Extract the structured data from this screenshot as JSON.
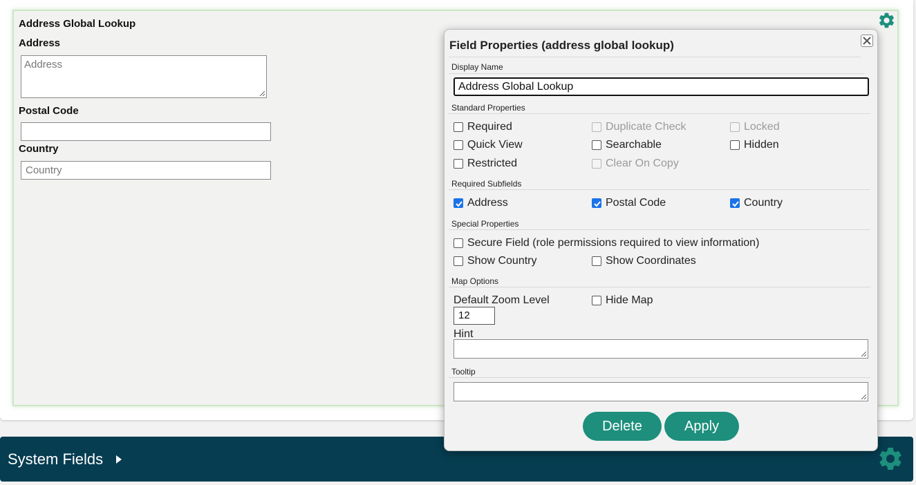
{
  "form": {
    "field_title": "Address Global Lookup",
    "address_label": "Address",
    "address_placeholder": "Address",
    "postal_label": "Postal Code",
    "postal_value": "",
    "country_label": "Country",
    "country_placeholder": "Country"
  },
  "bottom_bar": {
    "title": "System Fields"
  },
  "dialog": {
    "title": "Field Properties (address global lookup)",
    "display_name_label": "Display Name",
    "display_name_value": "Address Global Lookup",
    "standard_label": "Standard Properties",
    "standard": {
      "required": "Required",
      "duplicate_check": "Duplicate Check",
      "locked": "Locked",
      "quick_view": "Quick View",
      "searchable": "Searchable",
      "hidden": "Hidden",
      "restricted": "Restricted",
      "clear_on_copy": "Clear On Copy"
    },
    "subfields_label": "Required Subfields",
    "subfields": {
      "address": "Address",
      "postal_code": "Postal Code",
      "country": "Country"
    },
    "special_label": "Special Properties",
    "special": {
      "secure_field": "Secure Field (role permissions required to view information)",
      "show_country": "Show Country",
      "show_coordinates": "Show Coordinates"
    },
    "map_label": "Map Options",
    "map": {
      "zoom_label": "Default Zoom Level",
      "zoom_value": "12",
      "hide_map": "Hide Map"
    },
    "hint_label": "Hint",
    "tooltip_label": "Tooltip",
    "delete_label": "Delete",
    "apply_label": "Apply"
  },
  "colors": {
    "accent_teal": "#1d8f7c",
    "bar_navy": "#063d51",
    "checkbox_blue": "#1a73e8"
  },
  "icons": {
    "gear": "gear-icon",
    "close": "close-icon",
    "expand": "triangle-right-icon"
  }
}
